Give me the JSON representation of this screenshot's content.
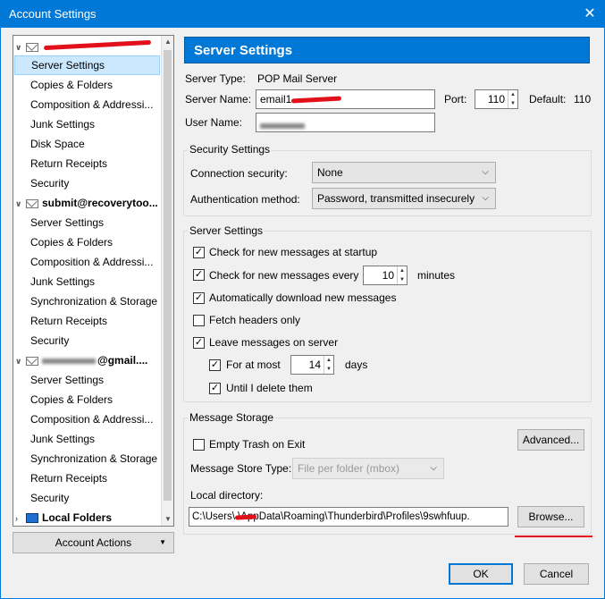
{
  "window": {
    "title": "Account Settings",
    "close_glyph": "✕"
  },
  "tree": {
    "accounts": [
      {
        "name": "",
        "items": [
          "Server Settings",
          "Copies & Folders",
          "Composition & Addressi...",
          "Junk Settings",
          "Disk Space",
          "Return Receipts",
          "Security"
        ]
      },
      {
        "name": "submit@recoverytoo...",
        "items": [
          "Server Settings",
          "Copies & Folders",
          "Composition & Addressi...",
          "Junk Settings",
          "Synchronization & Storage",
          "Return Receipts",
          "Security"
        ]
      },
      {
        "name": "@gmail....",
        "items": [
          "Server Settings",
          "Copies & Folders",
          "Composition & Addressi...",
          "Junk Settings",
          "Synchronization & Storage",
          "Return Receipts",
          "Security"
        ]
      }
    ],
    "local_folders": "Local Folders"
  },
  "account_actions": "Account Actions",
  "panel": {
    "header": "Server Settings",
    "server_type_label": "Server Type:",
    "server_type_value": "POP Mail Server",
    "server_name_label": "Server Name:",
    "server_name_value": "email1",
    "port_label": "Port:",
    "port_value": "110",
    "default_label": "Default:",
    "default_value": "110",
    "user_name_label": "User Name:",
    "security_group": "Security Settings",
    "conn_sec_label": "Connection security:",
    "conn_sec_value": "None",
    "auth_label": "Authentication method:",
    "auth_value": "Password, transmitted insecurely",
    "server_group": "Server Settings",
    "check_startup": "Check for new messages at startup",
    "check_every": "Check for new messages every",
    "check_every_value": "10",
    "minutes": "minutes",
    "auto_download": "Automatically download new messages",
    "fetch_headers": "Fetch headers only",
    "leave_messages": "Leave messages on server",
    "for_at_most": "For at most",
    "for_at_most_value": "14",
    "days": "days",
    "until_delete": "Until I delete them",
    "storage_group": "Message Storage",
    "empty_trash": "Empty Trash on Exit",
    "advanced": "Advanced...",
    "store_type_label": "Message Store Type:",
    "store_type_value": "File per folder (mbox)",
    "local_dir_label": "Local directory:",
    "local_dir_value": "C:\\Users\\      \\AppData\\Roaming\\Thunderbird\\Profiles\\9swhfuup.",
    "browse": "Browse..."
  },
  "footer": {
    "ok": "OK",
    "cancel": "Cancel"
  },
  "colors": {
    "accent": "#0078d7",
    "redaction": "#e2101a"
  }
}
